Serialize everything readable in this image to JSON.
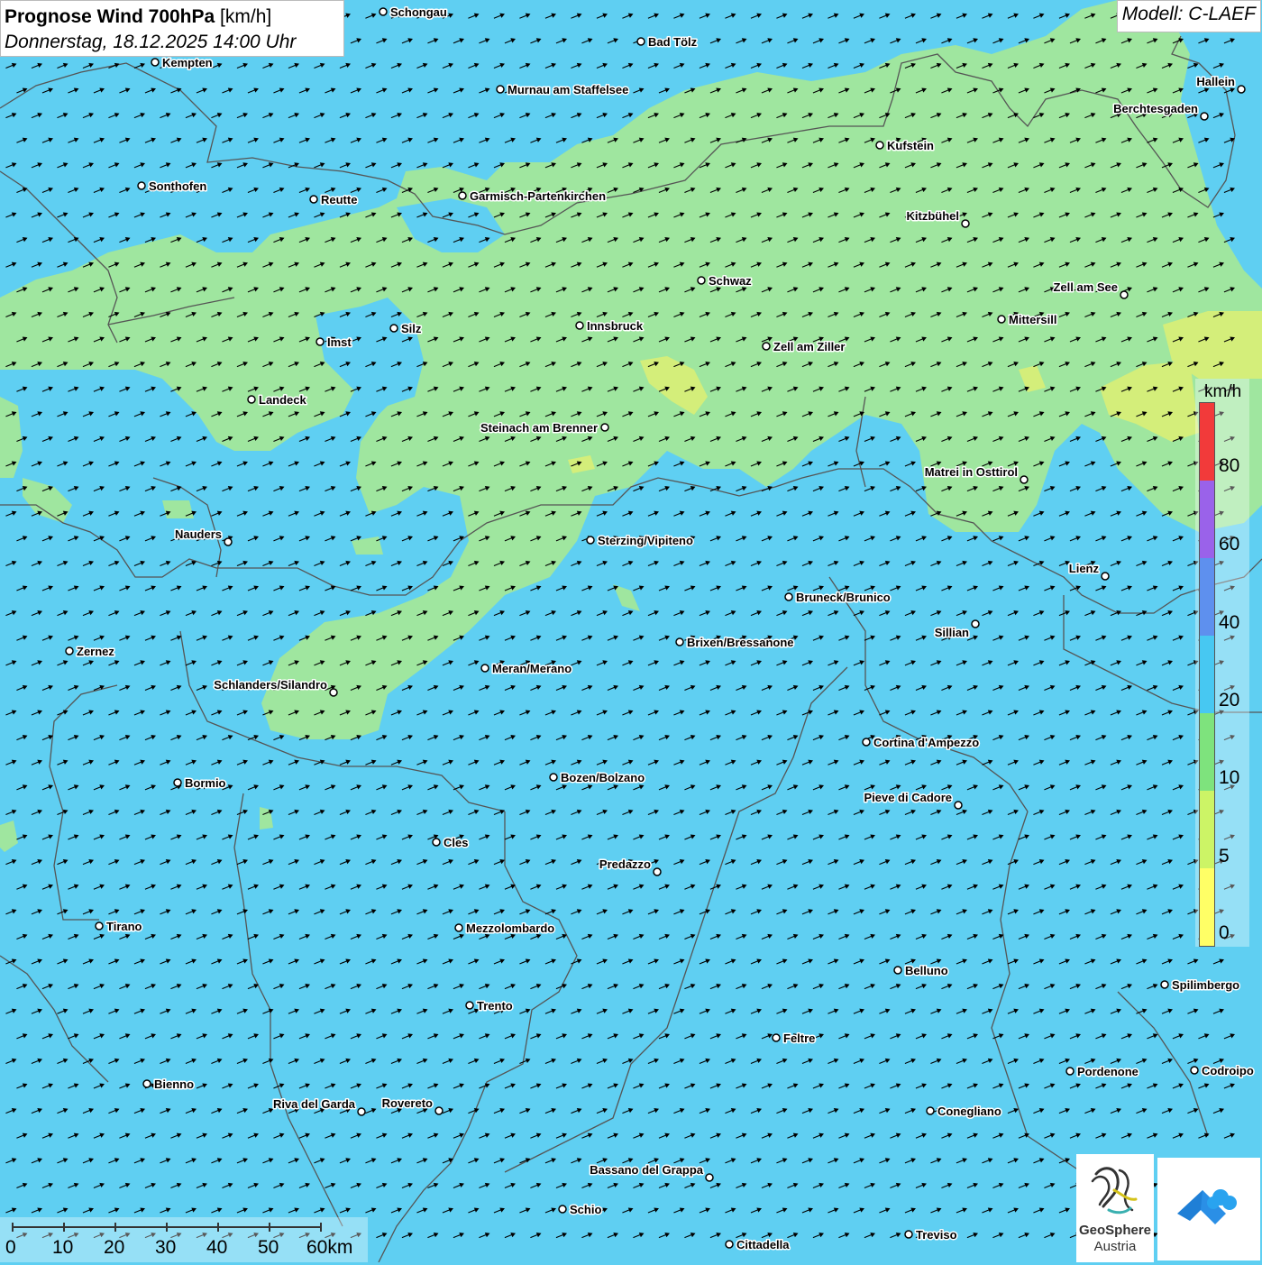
{
  "header": {
    "title_bold": "Prognose Wind 700hPa",
    "title_unit": "[km/h]",
    "subtitle": "Donnerstag, 18.12.2025 14:00 Uhr",
    "model": "Modell: C-LAEF"
  },
  "legend": {
    "unit": "km/h",
    "ticks": [
      "0",
      "5",
      "10",
      "20",
      "40",
      "60",
      "80"
    ],
    "colors": [
      "#ffff66",
      "#ccf466",
      "#7ee37d",
      "#47c8f2",
      "#5e90ee",
      "#9a62ea",
      "#f23a3a"
    ]
  },
  "scale": {
    "labels": [
      "0",
      "10",
      "20",
      "30",
      "40",
      "50",
      "60km"
    ]
  },
  "logo": {
    "name_line1": "GeoSphere",
    "name_line2": "Austria"
  },
  "colors": {
    "sea_blue": "#5fcff2",
    "green_zone": "#9fe69f",
    "yellow_zone": "#d4ee7a",
    "border": "#555555",
    "arrow": "#000000"
  },
  "cities": [
    {
      "name": "Schongau"
    },
    {
      "name": "Bad Tölz"
    },
    {
      "name": "Kempten"
    },
    {
      "name": "Murnau am Staffelsee"
    },
    {
      "name": "Hallein"
    },
    {
      "name": "Berchtesgaden"
    },
    {
      "name": "Kufstein"
    },
    {
      "name": "Sonthofen"
    },
    {
      "name": "Reutte"
    },
    {
      "name": "Garmisch-Partenkirchen"
    },
    {
      "name": "Kitzbühel"
    },
    {
      "name": "Schwaz"
    },
    {
      "name": "Zell am See"
    },
    {
      "name": "Mittersill"
    },
    {
      "name": "Innsbruck"
    },
    {
      "name": "Silz"
    },
    {
      "name": "Imst"
    },
    {
      "name": "Zell am Ziller"
    },
    {
      "name": "Landeck"
    },
    {
      "name": "Steinach am Brenner"
    },
    {
      "name": "Matrei in Osttirol"
    },
    {
      "name": "Nauders"
    },
    {
      "name": "Sterzing/Vipiteno"
    },
    {
      "name": "Lienz"
    },
    {
      "name": "Bruneck/Brunico"
    },
    {
      "name": "Sillian"
    },
    {
      "name": "Brixen/Bressanone"
    },
    {
      "name": "Zernez"
    },
    {
      "name": "Meran/Merano"
    },
    {
      "name": "Schlanders/Silandro"
    },
    {
      "name": "Cortina d'Ampezzo"
    },
    {
      "name": "Bozen/Bolzano"
    },
    {
      "name": "Bormio"
    },
    {
      "name": "Pieve di Cadore"
    },
    {
      "name": "Cles"
    },
    {
      "name": "Predazzo"
    },
    {
      "name": "Tirano"
    },
    {
      "name": "Mezzolombardo"
    },
    {
      "name": "Belluno"
    },
    {
      "name": "Spilimbergo"
    },
    {
      "name": "Trento"
    },
    {
      "name": "Feltre"
    },
    {
      "name": "Pordenone"
    },
    {
      "name": "Codroipo"
    },
    {
      "name": "Bienno"
    },
    {
      "name": "Riva del Garda"
    },
    {
      "name": "Rovereto"
    },
    {
      "name": "Conegliano"
    },
    {
      "name": "Bassano del Grappa"
    },
    {
      "name": "Schio"
    },
    {
      "name": "Treviso"
    },
    {
      "name": "Cittadella"
    }
  ]
}
